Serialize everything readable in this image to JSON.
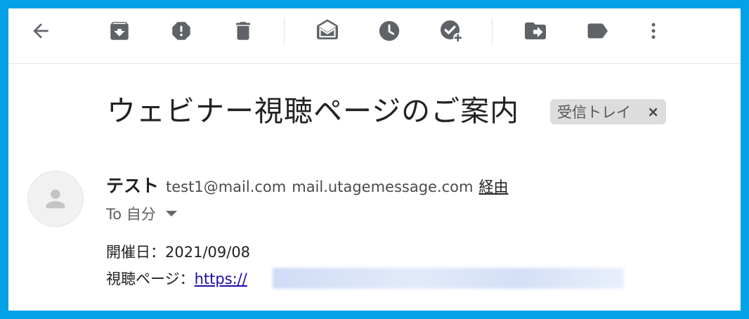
{
  "toolbar": {
    "icons": [
      "back-arrow-icon",
      "archive-icon",
      "report-spam-icon",
      "delete-icon",
      "mark-unread-icon",
      "snooze-icon",
      "add-task-icon",
      "move-to-icon",
      "label-icon",
      "more-vert-icon"
    ]
  },
  "email": {
    "subject": "ウェビナー視聴ページのご案内",
    "label": "受信トレイ",
    "label_close": "×",
    "sender_name": "テスト",
    "sender_email": "test1@mail.com",
    "via_domain": "mail.utagemessage.com",
    "via_label": "経由",
    "to_text": "To 自分",
    "body_line1": "開催日：2021/09/08",
    "body_line2_prefix": "視聴ページ：",
    "url_visible": "https://"
  },
  "colors": {
    "frame_border": "#03a1e8",
    "icon_gray": "#5f6368",
    "link": "#1a0dab"
  }
}
